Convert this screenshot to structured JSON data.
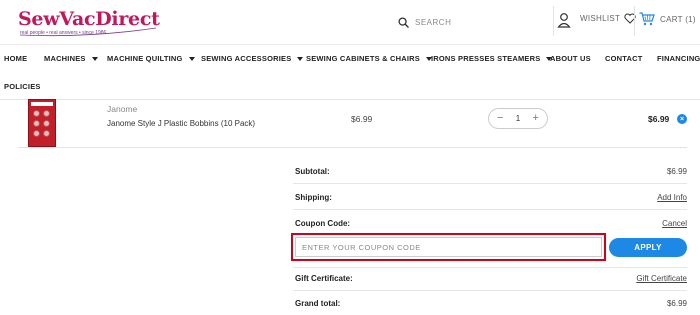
{
  "brand": {
    "logo_text": "SewVacDirect",
    "tagline": "real people • real answers • since 1986",
    "logo_color": "#c2185b"
  },
  "header": {
    "search_placeholder": "SEARCH",
    "search_icon": "search-icon",
    "account_icon": "user-icon",
    "wishlist_label": "WISHLIST",
    "wishlist_icon": "heart-icon",
    "cart_label": "CART (1)",
    "cart_icon": "cart-icon"
  },
  "nav": {
    "items": [
      {
        "label": "HOME",
        "has_dropdown": false
      },
      {
        "label": "MACHINES",
        "has_dropdown": true
      },
      {
        "label": "MACHINE QUILTING",
        "has_dropdown": true
      },
      {
        "label": "SEWING ACCESSORIES",
        "has_dropdown": true
      },
      {
        "label": "SEWING CABINETS & CHAIRS",
        "has_dropdown": true
      },
      {
        "label": "IRONS PRESSES STEAMERS",
        "has_dropdown": true
      },
      {
        "label": "ABOUT US",
        "has_dropdown": false
      },
      {
        "label": "CONTACT",
        "has_dropdown": false
      },
      {
        "label": "FINANCING",
        "has_dropdown": false
      },
      {
        "label": "POLICIES",
        "has_dropdown": false
      }
    ]
  },
  "cart_item": {
    "brand": "Janome",
    "name": "Janome Style J Plastic Bobbins (10 Pack)",
    "price": "$6.99",
    "quantity": "1",
    "decrement": "−",
    "increment": "+",
    "total": "$6.99",
    "remove_icon": "close-icon",
    "remove_glyph": "×"
  },
  "summary": {
    "subtotal_label": "Subtotal:",
    "subtotal_value": "$6.99",
    "shipping_label": "Shipping:",
    "shipping_link": "Add Info",
    "coupon_label": "Coupon Code:",
    "coupon_cancel": "Cancel",
    "coupon_placeholder": "ENTER YOUR COUPON CODE",
    "apply_label": "APPLY",
    "gift_label": "Gift Certificate:",
    "gift_link": "Gift Certificate",
    "grand_total_label": "Grand total:",
    "grand_total_value": "$6.99"
  },
  "colors": {
    "accent": "#1e88e5",
    "highlight_border": "#d0021b"
  }
}
